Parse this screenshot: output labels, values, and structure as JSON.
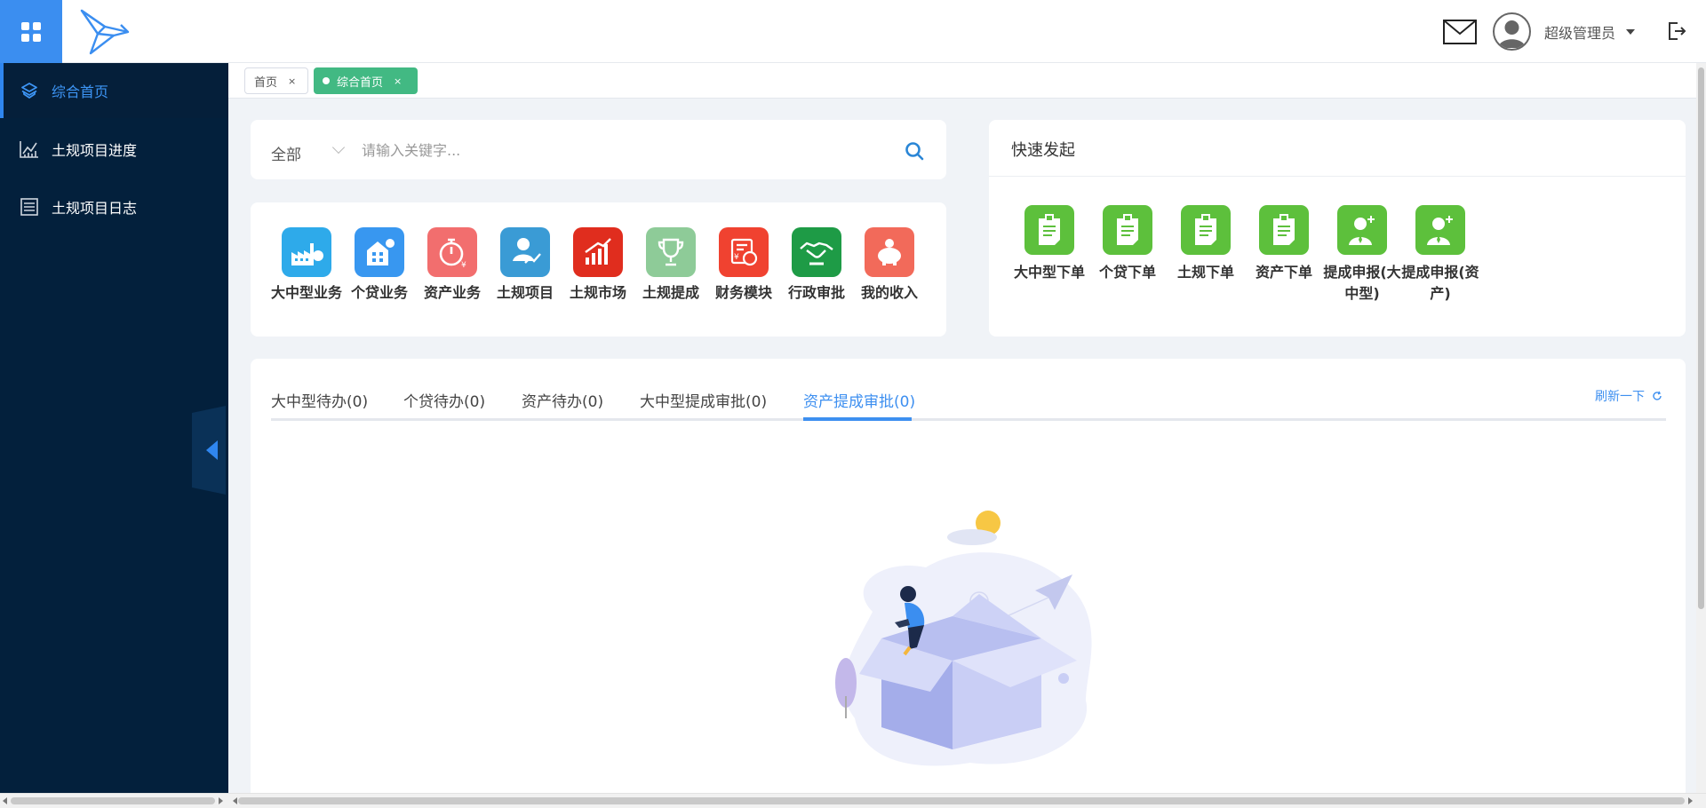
{
  "header": {
    "username": "超级管理员",
    "icons": [
      "apps-grid-icon",
      "bird-logo",
      "mail-icon",
      "avatar-icon",
      "caret-down-icon",
      "logout-icon"
    ]
  },
  "sidebar": {
    "items": [
      {
        "label": "综合首页",
        "icon": "layers-icon",
        "active": true
      },
      {
        "label": "土规项目进度",
        "icon": "chart-icon",
        "active": false
      },
      {
        "label": "土规项目日志",
        "icon": "list-icon",
        "active": false
      }
    ]
  },
  "tabs": {
    "home": {
      "label": "首页",
      "close": "×"
    },
    "current": {
      "label": "综合首页",
      "close": "×"
    }
  },
  "search": {
    "scope": "全部",
    "placeholder": "请输入关键字..."
  },
  "modules": [
    {
      "label": "大中型业务",
      "color": "#2eaaea",
      "icon": "factory-icon"
    },
    {
      "label": "个贷业务",
      "color": "#3897f0",
      "icon": "building-icon"
    },
    {
      "label": "资产业务",
      "color": "#f26e6e",
      "icon": "stopwatch-icon"
    },
    {
      "label": "土规项目",
      "color": "#3a9bd5",
      "icon": "person-trend-icon"
    },
    {
      "label": "土规市场",
      "color": "#e02d1e",
      "icon": "bar-chart-icon"
    },
    {
      "label": "土规提成",
      "color": "#8ecb98",
      "icon": "trophy-icon"
    },
    {
      "label": "财务模块",
      "color": "#f04230",
      "icon": "finance-icon"
    },
    {
      "label": "行政审批",
      "color": "#1e9b46",
      "icon": "handshake-icon"
    },
    {
      "label": "我的收入",
      "color": "#f26a5a",
      "icon": "piggy-bank-icon"
    }
  ],
  "quick": {
    "title": "快速发起",
    "items": [
      {
        "label": "大中型下单",
        "icon": "clipboard-icon"
      },
      {
        "label": "个贷下单",
        "icon": "clipboard-icon"
      },
      {
        "label": "土规下单",
        "icon": "clipboard-icon"
      },
      {
        "label": "资产下单",
        "icon": "clipboard-icon"
      },
      {
        "label": "提成申报(大中型)",
        "icon": "user-add-icon"
      },
      {
        "label": "提成申报(资产)",
        "icon": "user-add-icon"
      }
    ]
  },
  "todo": {
    "tabs": [
      "大中型待办(0)",
      "个贷待办(0)",
      "资产待办(0)",
      "大中型提成审批(0)",
      "资产提成审批(0)"
    ],
    "active_tab": "资产提成审批(0)",
    "refresh_label": "刷新一下",
    "empty_state": "empty-box-illustration"
  },
  "colors": {
    "accent": "#3d8ff0",
    "sidebar": "#03203c",
    "tab_active": "#42b983",
    "quick_tile": "#5dc03c"
  }
}
